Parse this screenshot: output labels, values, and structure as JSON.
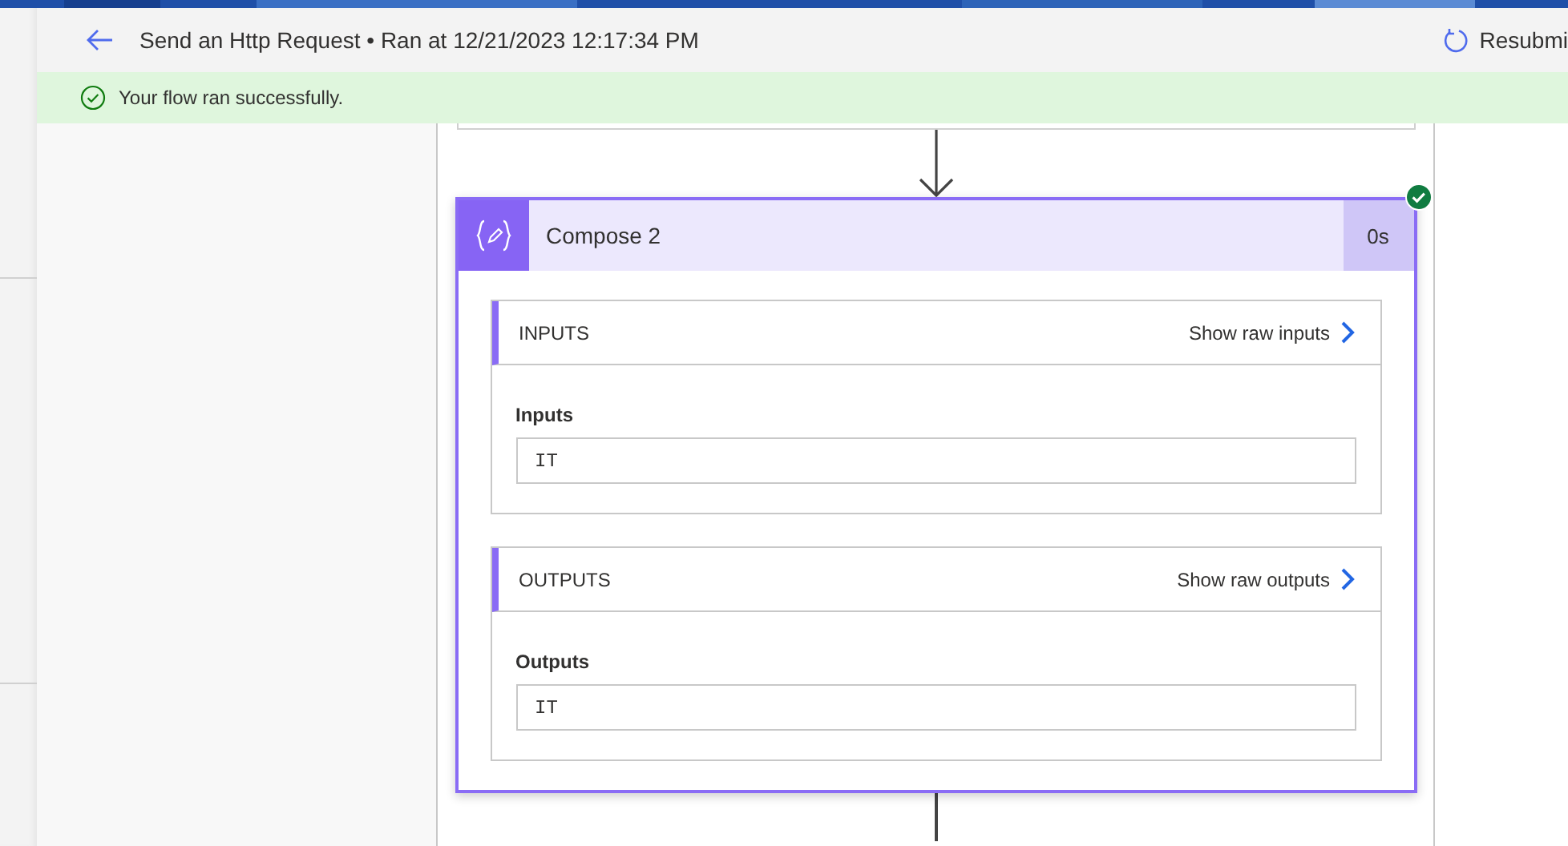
{
  "header": {
    "title": "Send an Http Request • Ran at 12/21/2023 12:17:34 PM",
    "resubmit": "Resubmi"
  },
  "banner": {
    "message": "Your flow ran successfully."
  },
  "action": {
    "title": "Compose 2",
    "duration": "0s",
    "succeeded": true,
    "sections": [
      {
        "heading": "INPUTS",
        "link": "Show raw inputs",
        "field_label": "Inputs",
        "value": "IT"
      },
      {
        "heading": "OUTPUTS",
        "link": "Show raw outputs",
        "field_label": "Outputs",
        "value": "IT"
      }
    ]
  }
}
